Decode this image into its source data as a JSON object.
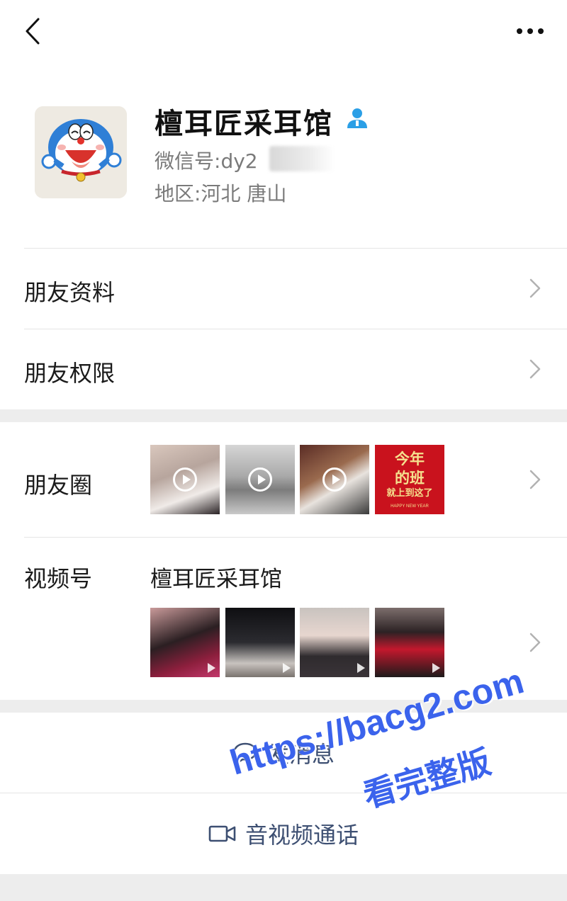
{
  "header": {
    "back_icon": "chevron-left-icon",
    "more_icon": "more-dots-icon"
  },
  "profile": {
    "name": "檀耳匠采耳馆",
    "wechat_id_label": "微信号:",
    "wechat_id_value": "dy2",
    "region_label": "地区:",
    "region_value": "河北 唐山",
    "avatar": "doraemon-avatar",
    "verify_icon": "contact-person-icon",
    "verify_color": "#2b9fe6"
  },
  "menu": [
    {
      "label": "朋友资料"
    },
    {
      "label": "朋友权限"
    }
  ],
  "moments": {
    "label": "朋友圈",
    "poster": {
      "text_line1": "今年",
      "text_line2": "的班",
      "text_line3": "就上到这了",
      "footer": "HAPPY NEW YEAR"
    }
  },
  "channels": {
    "label": "视频号",
    "channel_name": "檀耳匠采耳馆"
  },
  "actions": {
    "message_label": "发消息",
    "call_label": "音视频通话",
    "link_color": "#3d4f72"
  },
  "watermark": {
    "line1": "https://bacg2.com",
    "line2": "看完整版",
    "color": "#3b63ec"
  }
}
